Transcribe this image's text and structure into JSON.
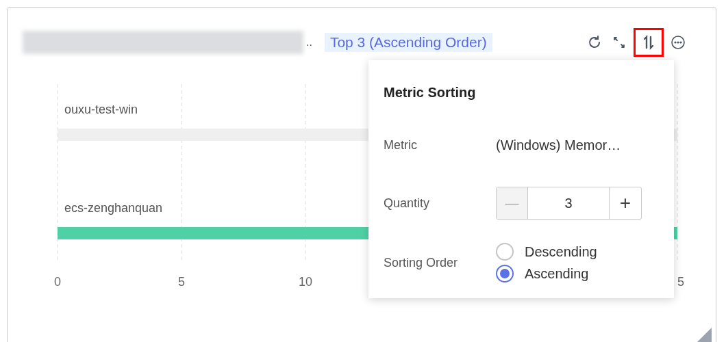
{
  "header": {
    "title_tail": "..",
    "badge": "Top 3 (Ascending Order)",
    "tools": [
      {
        "kind": "refresh",
        "highlighted": false
      },
      {
        "kind": "expand",
        "highlighted": false
      },
      {
        "kind": "sort",
        "highlighted": true
      },
      {
        "kind": "more",
        "highlighted": false
      }
    ]
  },
  "chart": {
    "rows": [
      {
        "label": "ouxu-test-win",
        "color": "#efefef"
      },
      {
        "label": "ecs-zenghanquan",
        "color": "#4fd1a5"
      }
    ],
    "ticks": [
      "0",
      "5",
      "10",
      "5"
    ]
  },
  "popover": {
    "title": "Metric Sorting",
    "metric_label": "Metric",
    "metric_value": "(Windows) Memor…",
    "quantity_label": "Quantity",
    "quantity": "3",
    "minus": "—",
    "plus": "+",
    "order_label": "Sorting Order",
    "options": [
      {
        "label": "Descending",
        "selected": false
      },
      {
        "label": "Ascending",
        "selected": true
      }
    ]
  }
}
